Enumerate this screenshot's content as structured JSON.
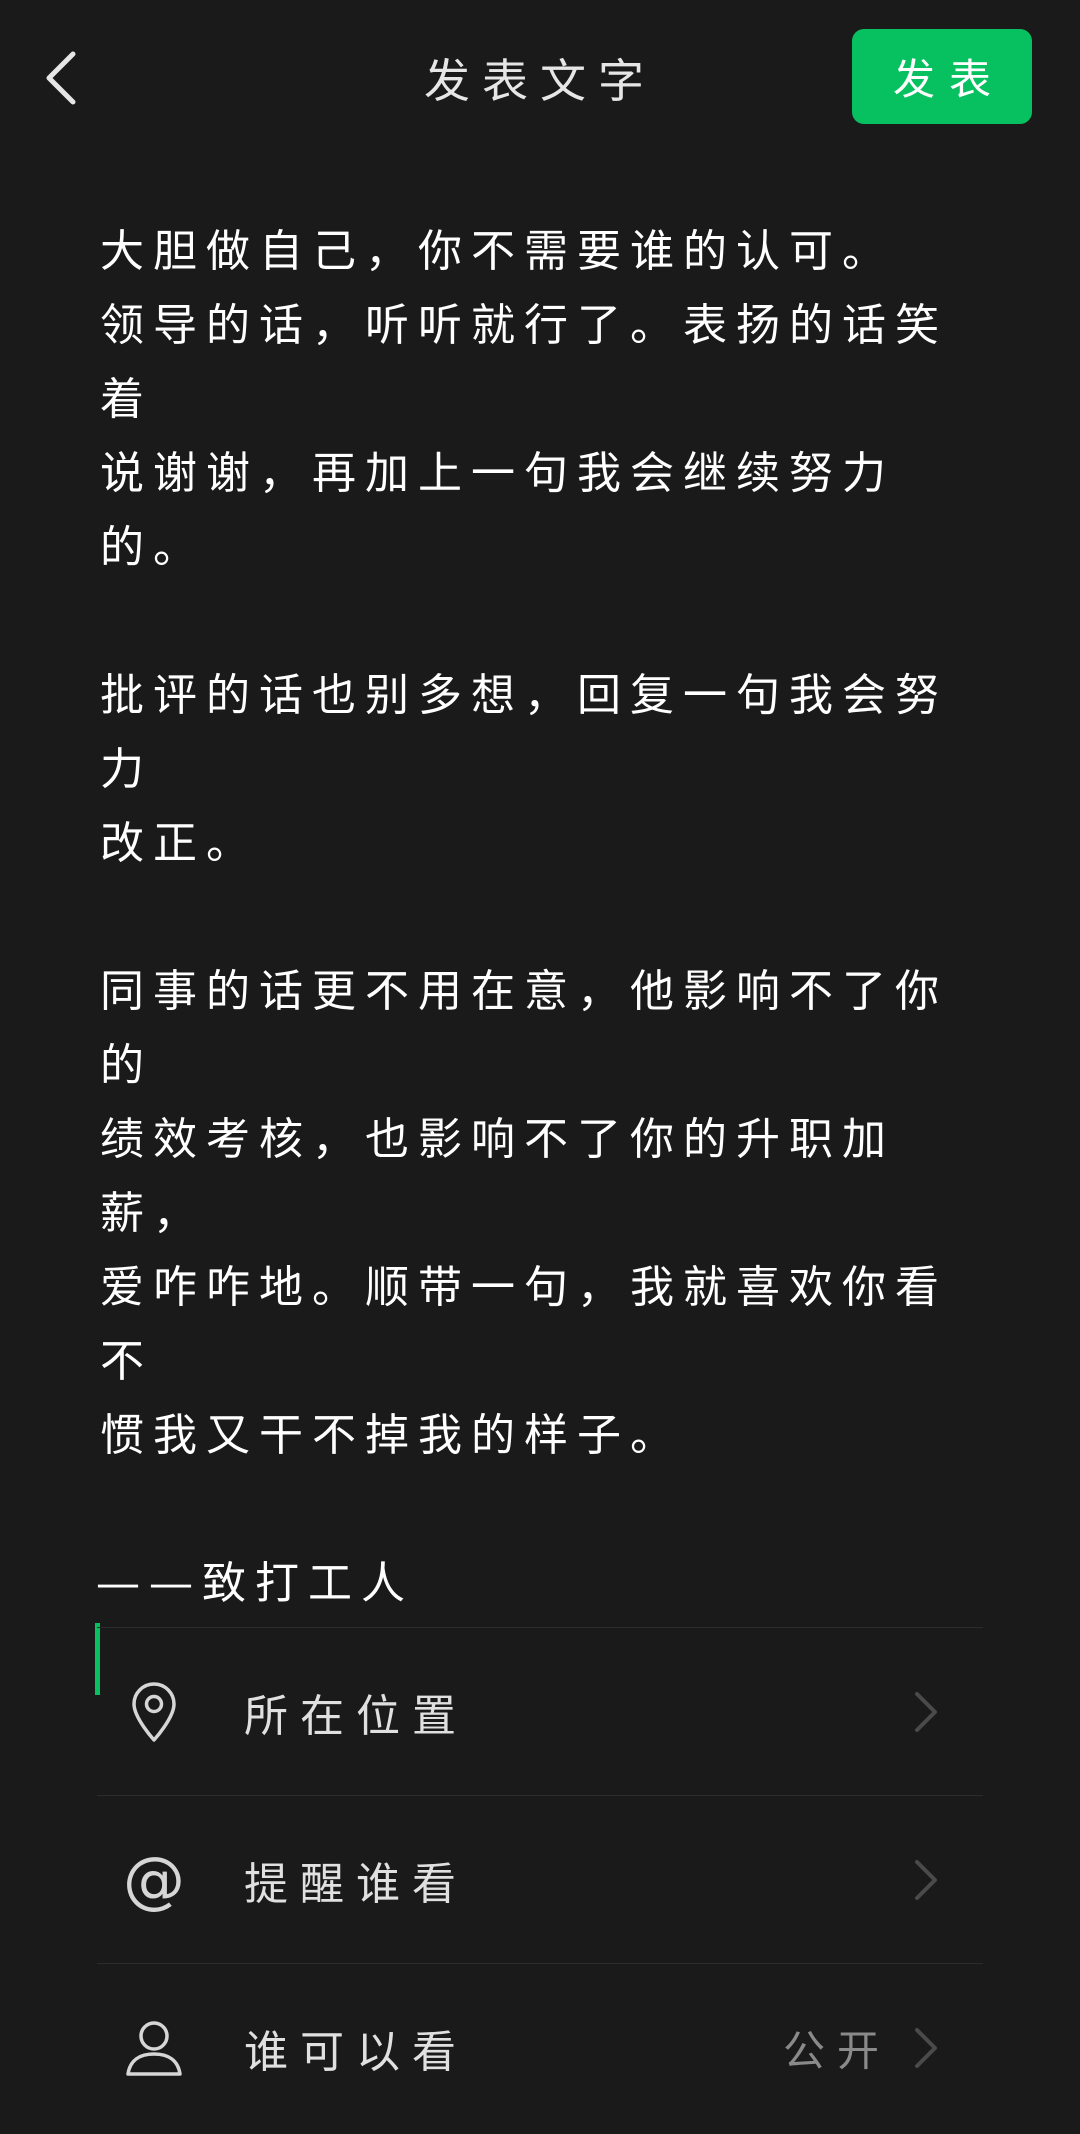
{
  "header": {
    "title": "发表文字",
    "back_icon": "chevron-left-icon",
    "publish_label": "发表",
    "accent_color": "#07c160"
  },
  "editor": {
    "paragraphs": [
      [
        "大胆做自己，你不需要谁的认可。",
        "领导的话，听听就行了。表扬的话笑着",
        "说谢谢，再加上一句我会继续努力的。"
      ],
      [
        "批评的话也别多想，回复一句我会努力",
        "改正。"
      ],
      [
        "同事的话更不用在意，他影响不了你的",
        "绩效考核，也影响不了你的升职加薪，",
        "爱咋咋地。顺带一句，我就喜欢你看不",
        "惯我又干不掉我的样子。"
      ]
    ],
    "signature": "——致打工人"
  },
  "options": [
    {
      "icon": "location-pin-icon",
      "label": "所在位置",
      "value": ""
    },
    {
      "icon": "at-sign-icon",
      "label": "提醒谁看",
      "value": "",
      "icon_glyph": "@"
    },
    {
      "icon": "person-icon",
      "label": "谁可以看",
      "value": "公开"
    }
  ]
}
